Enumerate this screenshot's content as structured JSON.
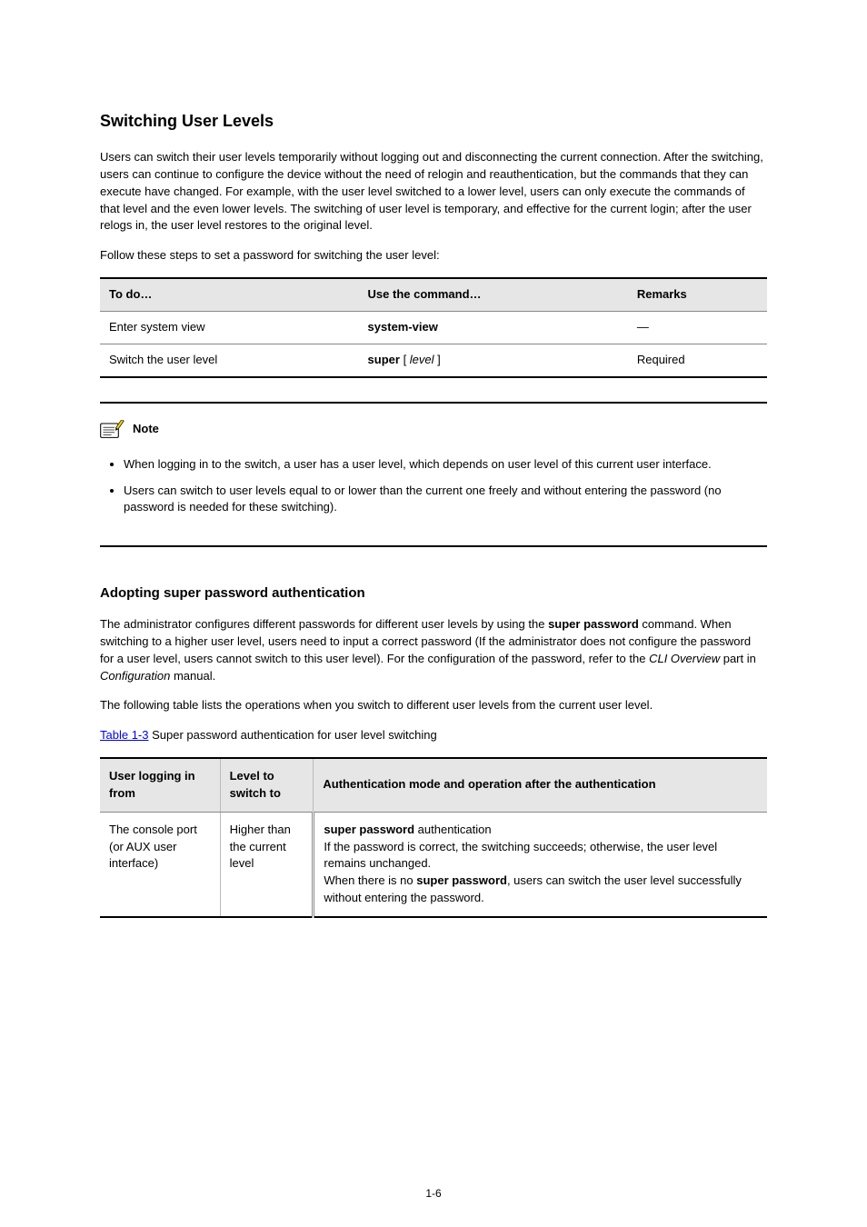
{
  "section_title": "Switching User Levels",
  "intro_para": "Users can switch their user levels temporarily without logging out and disconnecting the current connection. After the switching, users can continue to configure the device without the need of relogin and reauthentication, but the commands that they can execute have changed. For example, with the user level switched to a lower level, users can only execute the commands of that level and the even lower levels. The switching of user level is temporary, and effective for the current login; after the user relogs in, the user level restores to the original level.",
  "follow_steps": "Follow these steps to set a password for switching the user level:",
  "table1": {
    "headers": [
      "To do…",
      "Use the command…",
      "Remarks"
    ],
    "rows": [
      {
        "task": "Enter system view",
        "command": "system-view",
        "remarks": "—"
      },
      {
        "task": "Switch the user level",
        "command_html": "<span class='cmd-text'>super</span> [ <i>level</i> ]",
        "remarks": "Required"
      }
    ]
  },
  "note_label": "Note",
  "note_items": [
    "When logging in to the switch, a user has a user level, which depends on user level of this current user interface.",
    "Users can switch to user levels equal to or lower than the current one freely and without entering the password (no password is needed for these switching)."
  ],
  "sub_title": "Adopting super password authentication",
  "sub_para_html": "The administrator configures different passwords for different user levels by using the <b>super password</b> command. When switching to a higher user level, users need to input a correct password (If the administrator does not configure the password for a user level, users cannot switch to this user level). For the configuration of the password, refer to the <i>CLI Overview</i> part in <i>Configuration</i> manual.",
  "sub_para2": "The following table lists the operations when you switch to different user levels from the current user level.",
  "table2_caption_html": "<b>Table 1-3</b> Super password authentication for user level switching",
  "xref_text": "Table 1-3",
  "table2": {
    "headers": [
      "User logging in from",
      "Level to switch to",
      "Authentication mode and operation after the authentication"
    ],
    "row": {
      "col1_html": "The console port (or AUX user interface)",
      "col2": "Higher than the current level",
      "col3_html": "<b>super password</b> authentication<br>If the password is correct, the switching succeeds; otherwise, the user level remains unchanged.<br>When there is no <b>super password</b>, users can switch the user level successfully without entering the password."
    }
  },
  "page_number": "1-6"
}
